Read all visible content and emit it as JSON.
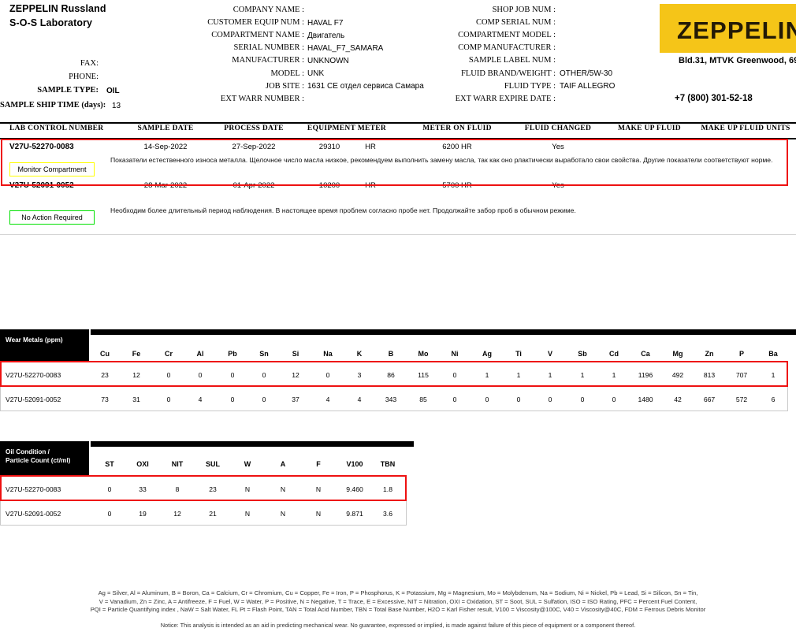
{
  "header": {
    "company_line1": "ZEPPELIN Russland",
    "company_line2": "S-O-S Laboratory",
    "left_fields": [
      {
        "label": "FAX:",
        "value": ""
      },
      {
        "label": "PHONE:",
        "value": ""
      },
      {
        "label": "SAMPLE TYPE:",
        "value": "OIL"
      },
      {
        "label": "SAMPLE SHIP TIME  (days):",
        "value": "13"
      }
    ],
    "mid_fields": [
      {
        "label": "COMPANY NAME :",
        "value": ""
      },
      {
        "label": "CUSTOMER EQUIP NUM :",
        "value": "HAVAL F7"
      },
      {
        "label": "COMPARTMENT NAME :",
        "value": "Двигатель"
      },
      {
        "label": "SERIAL NUMBER :",
        "value": "HAVAL_F7_SAMARA"
      },
      {
        "label": "MANUFACTURER :",
        "value": "UNKNOWN"
      },
      {
        "label": "MODEL :",
        "value": "UNK"
      },
      {
        "label": "JOB SITE :",
        "value": "1631 CE отдел сервиса Самара"
      },
      {
        "label": "EXT WARR NUMBER :",
        "value": ""
      }
    ],
    "right_fields": [
      {
        "label": "SHOP JOB NUM :",
        "value": ""
      },
      {
        "label": "COMP SERIAL NUM :",
        "value": ""
      },
      {
        "label": "COMPARTMENT MODEL :",
        "value": ""
      },
      {
        "label": "COMP MANUFACTURER :",
        "value": ""
      },
      {
        "label": "SAMPLE LABEL NUM :",
        "value": ""
      },
      {
        "label": "FLUID BRAND/WEIGHT :",
        "value": "OTHER/5W-30"
      },
      {
        "label": "FLUID TYPE :",
        "value": "TAIF ALLEGRO"
      },
      {
        "label": "EXT WARR EXPIRE DATE :",
        "value": ""
      }
    ],
    "logo_text": "ZEPPELIN",
    "logo_color": "#f5c518",
    "address": "Bld.31, MTVK Greenwood, 69",
    "phone": "+7 (800) 301-52-18"
  },
  "lab_table": {
    "columns": [
      "LAB CONTROL NUMBER",
      "SAMPLE  DATE",
      "PROCESS DATE",
      "EQUIPMENT METER",
      "METER ON FLUID",
      "FLUID CHANGED",
      "MAKE UP FLUID",
      "MAKE UP FLUID UNITS"
    ],
    "rows": [
      {
        "lab_control_number": "V27U-52270-0083",
        "sample_date": "14-Sep-2022",
        "process_date": "27-Sep-2022",
        "equipment_meter": "29310",
        "equipment_meter_unit": "HR",
        "meter_on_fluid": "6200 HR",
        "fluid_changed": "Yes",
        "make_up_fluid": "",
        "make_up_fluid_units": "",
        "badge_label": "Monitor Compartment",
        "badge_color": "#ffff00",
        "comment": "Показатели естественного износа металла. Щелочное число масла низкое, рекомендуем выполнить замену масла, так как оно рлактически выработало свои свойства. Другие показатели соответствуют норме.",
        "highlighted": true
      },
      {
        "lab_control_number": "V27U-52091-0052",
        "sample_date": "28-Mar-2022",
        "process_date": "01-Apr-2022",
        "equipment_meter": "10200",
        "equipment_meter_unit": "HR",
        "meter_on_fluid": "5700 HR",
        "fluid_changed": "Yes",
        "make_up_fluid": "",
        "make_up_fluid_units": "",
        "badge_label": "No Action Required",
        "badge_color": "#00e000",
        "comment": "Необходим более длительный период наблюдения. В настоящее время проблем согласно пробе нет.  Продолжайте забор проб в обычном режиме.",
        "highlighted": false
      }
    ]
  },
  "wear_metals": {
    "title": "Wear Metals (ppm)",
    "columns": [
      "Cu",
      "Fe",
      "Cr",
      "Al",
      "Pb",
      "Sn",
      "Si",
      "Na",
      "K",
      "B",
      "Mo",
      "Ni",
      "Ag",
      "Ti",
      "V",
      "Sb",
      "Cd",
      "Ca",
      "Mg",
      "Zn",
      "P",
      "Ba"
    ],
    "rows": [
      {
        "id": "V27U-52270-0083",
        "highlighted": true,
        "values": [
          "23",
          "12",
          "0",
          "0",
          "0",
          "0",
          "12",
          "0",
          "3",
          "86",
          "115",
          "0",
          "1",
          "1",
          "1",
          "1",
          "1",
          "1196",
          "492",
          "813",
          "707",
          "1"
        ]
      },
      {
        "id": "V27U-52091-0052",
        "highlighted": false,
        "values": [
          "73",
          "31",
          "0",
          "4",
          "0",
          "0",
          "37",
          "4",
          "4",
          "343",
          "85",
          "0",
          "0",
          "0",
          "0",
          "0",
          "0",
          "1480",
          "42",
          "667",
          "572",
          "6"
        ]
      }
    ]
  },
  "oil_condition": {
    "title_line1": "Oil Condition /",
    "title_line2": "Particle Count (ct/ml)",
    "columns": [
      "ST",
      "OXI",
      "NIT",
      "SUL",
      "W",
      "A",
      "F",
      "V100",
      "TBN"
    ],
    "rows": [
      {
        "id": "V27U-52270-0083",
        "highlighted": true,
        "values": [
          "0",
          "33",
          "8",
          "23",
          "N",
          "N",
          "N",
          "9.460",
          "1.8"
        ]
      },
      {
        "id": "V27U-52091-0052",
        "highlighted": false,
        "values": [
          "0",
          "19",
          "12",
          "21",
          "N",
          "N",
          "N",
          "9.871",
          "3.6"
        ]
      }
    ]
  },
  "footer": {
    "legend_line1": "Ag = Silver, Al = Aluminum, B = Boron, Ca = Calcium, Cr = Chromium, Cu = Copper, Fe = Iron, P = Phosphorus, K = Potassium, Mg = Magnesium,  Mo = Molybdenum, Na = Sodium, Ni = Nickel, Pb = Lead, Si = Silicon, Sn = Tin,",
    "legend_line2": "V = Vanadium, Zn = Zinc, A = Antifreeze, F = Fuel, W = Water,  P = Positive, N = Negative, T = Trace, E = Excessive, NIT = Nitration, OXI = Oxidation, ST = Soot, SUL = Sulfation, ISO = ISO Rating, PFC = Percent Fuel Content,",
    "legend_line3": "PQI = Particle Quantifying index , NaW = Salt Water, FL Pt = Flash Point, TAN = Total Acid Number, TBN = Total Base Number, H2O = Karl Fisher result, V100 = Viscosity@100C, V40 = Viscosity@40C, FDM = Ferrous Debris Monitor",
    "notice": "Notice: This analysis is intended as an aid in predicting mechanical wear.  No guarantee, expressed or implied, is made against failure of this piece of equipment or a component thereof."
  },
  "accent": {
    "red": "#ee1111",
    "black": "#000000",
    "gray_rule": "#d4d4d4"
  }
}
